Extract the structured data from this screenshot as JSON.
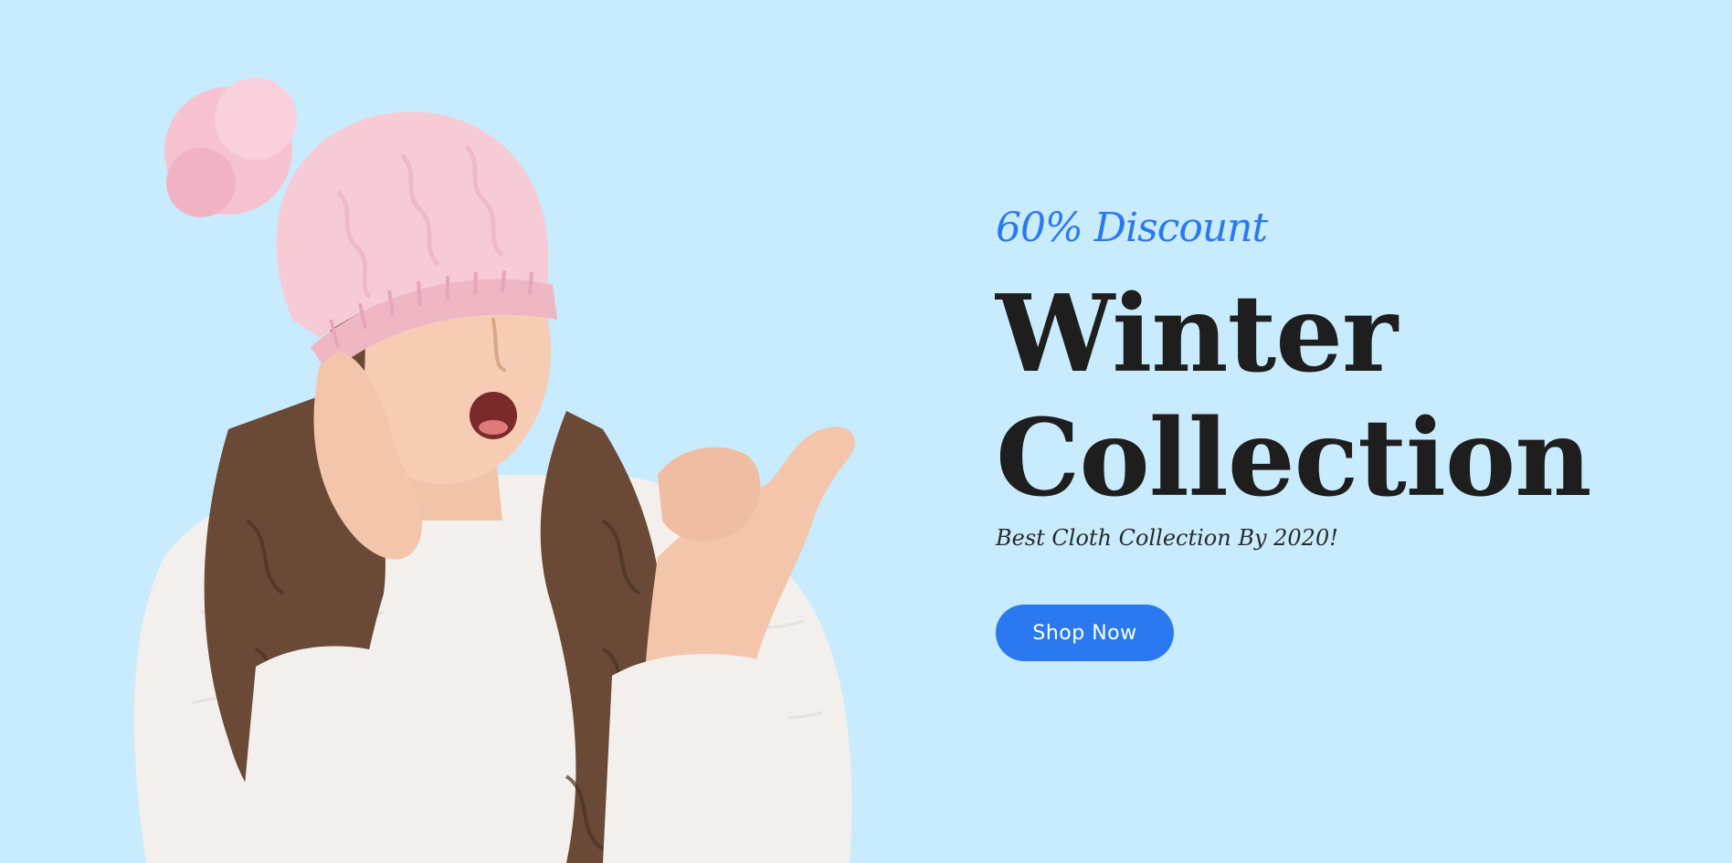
{
  "hero": {
    "background_color": "#c8ebfd",
    "accent_color": "#2a79f0",
    "discount_text": "60% Discount",
    "title_line1": "Winter",
    "title_line2": "Collection",
    "subtitle": "Best Cloth Collection By 2020!",
    "button_label": "Shop Now",
    "image_subject": "girl-in-pink-knit-hat-pointing-icon"
  }
}
